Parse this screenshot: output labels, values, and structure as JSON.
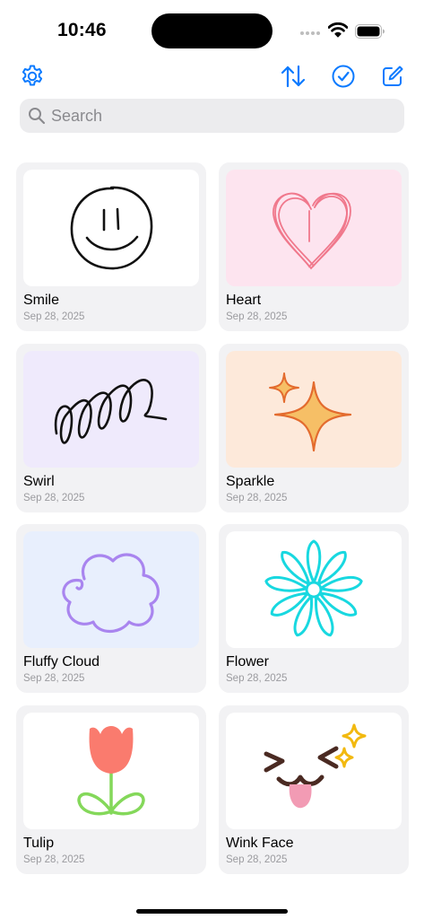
{
  "status_bar": {
    "time": "10:46",
    "icons": [
      "signal-dots-icon",
      "wifi-icon",
      "battery-icon"
    ]
  },
  "toolbar": {
    "accent_color": "#0a7aff",
    "settings_icon": "gear-icon",
    "sort_icon": "sort-arrows-icon",
    "select_icon": "checkmark-circle-icon",
    "compose_icon": "compose-icon"
  },
  "search": {
    "placeholder": "Search",
    "value": ""
  },
  "drawings": [
    {
      "title": "Smile",
      "date": "Sep 28, 2025",
      "thumb_color": "#ffffff",
      "art": "smiley-face"
    },
    {
      "title": "Heart",
      "date": "Sep 28, 2025",
      "thumb_color": "#fde4ef",
      "art": "scribbled-heart"
    },
    {
      "title": "Swirl",
      "date": "Sep 28, 2025",
      "thumb_color": "#efeafc",
      "art": "swirl-loops"
    },
    {
      "title": "Sparkle",
      "date": "Sep 28, 2025",
      "thumb_color": "#fde9da",
      "art": "sparkle-stars"
    },
    {
      "title": "Fluffy Cloud",
      "date": "Sep 28, 2025",
      "thumb_color": "#e8effd",
      "art": "cloud"
    },
    {
      "title": "Flower",
      "date": "Sep 28, 2025",
      "thumb_color": "#ffffff",
      "art": "daisy-flower"
    },
    {
      "title": "Tulip",
      "date": "Sep 28, 2025",
      "thumb_color": "#ffffff",
      "art": "tulip"
    },
    {
      "title": "Wink Face",
      "date": "Sep 28, 2025",
      "thumb_color": "#ffffff",
      "art": "wink-face"
    }
  ]
}
